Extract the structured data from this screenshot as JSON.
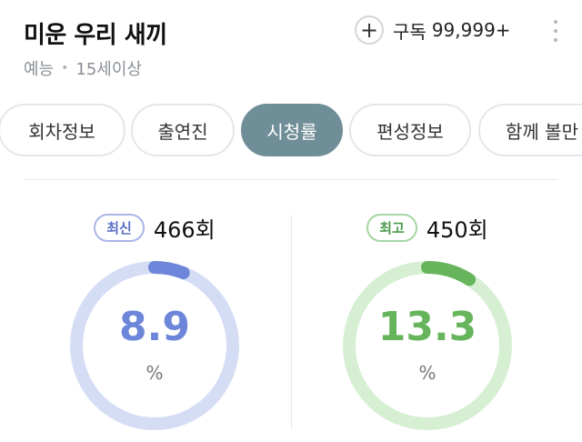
{
  "show": {
    "title": "미운 우리 새끼",
    "genre": "예능",
    "separator": "•",
    "age_rating": "15세이상"
  },
  "subscribe": {
    "label": "구독",
    "count": "99,999+"
  },
  "tabs": [
    {
      "label": "회차정보",
      "active": false
    },
    {
      "label": "출연진",
      "active": false
    },
    {
      "label": "시청률",
      "active": true
    },
    {
      "label": "편성정보",
      "active": false
    },
    {
      "label": "함께 볼만",
      "active": false
    }
  ],
  "latest": {
    "badge": "최신",
    "episode": "466회",
    "rating": "8.9",
    "unit": "%",
    "gauge_fraction": 0.06,
    "color": "#6d86d9",
    "track_color": "#d5ddf5"
  },
  "best": {
    "badge": "최고",
    "episode": "450회",
    "rating": "13.3",
    "unit": "%",
    "gauge_fraction": 0.09,
    "color": "#66b45b",
    "track_color": "#d6efd3"
  },
  "icons": {
    "subscribe": "plus-icon",
    "more": "more-vertical-icon"
  }
}
